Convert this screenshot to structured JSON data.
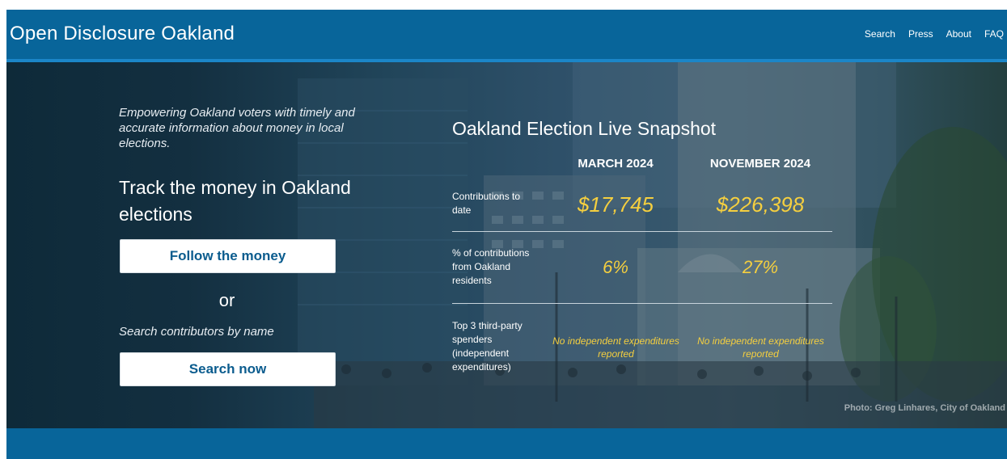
{
  "header": {
    "brand": "Open Disclosure Oakland",
    "nav": [
      "Search",
      "Press",
      "About",
      "FAQ"
    ]
  },
  "hero": {
    "tagline": "Empowering Oakland voters with timely and accurate information about money in local elections.",
    "track_heading": "Track the money in Oakland elections",
    "follow_button": "Follow the money",
    "or_text": "or",
    "search_prompt": "Search contributors by name",
    "search_button": "Search now",
    "photo_credit": "Photo: Greg Linhares, City of Oakland"
  },
  "snapshot": {
    "title": "Oakland Election Live Snapshot",
    "columns": [
      "MARCH 2024",
      "NOVEMBER 2024"
    ],
    "rows": [
      {
        "label": "Contributions to date",
        "values": [
          "$17,745",
          "$226,398"
        ]
      },
      {
        "label": "% of contributions from Oakland residents",
        "values": [
          "6%",
          "27%"
        ]
      },
      {
        "label": "Top 3 third-party spenders (independent expenditures)",
        "values": [
          "No independent expenditures reported",
          "No independent expenditures reported"
        ]
      }
    ]
  },
  "colors": {
    "header_blue": "#08659a",
    "accent_yellow": "#f5cf3f",
    "button_text": "#0b5c8e"
  }
}
